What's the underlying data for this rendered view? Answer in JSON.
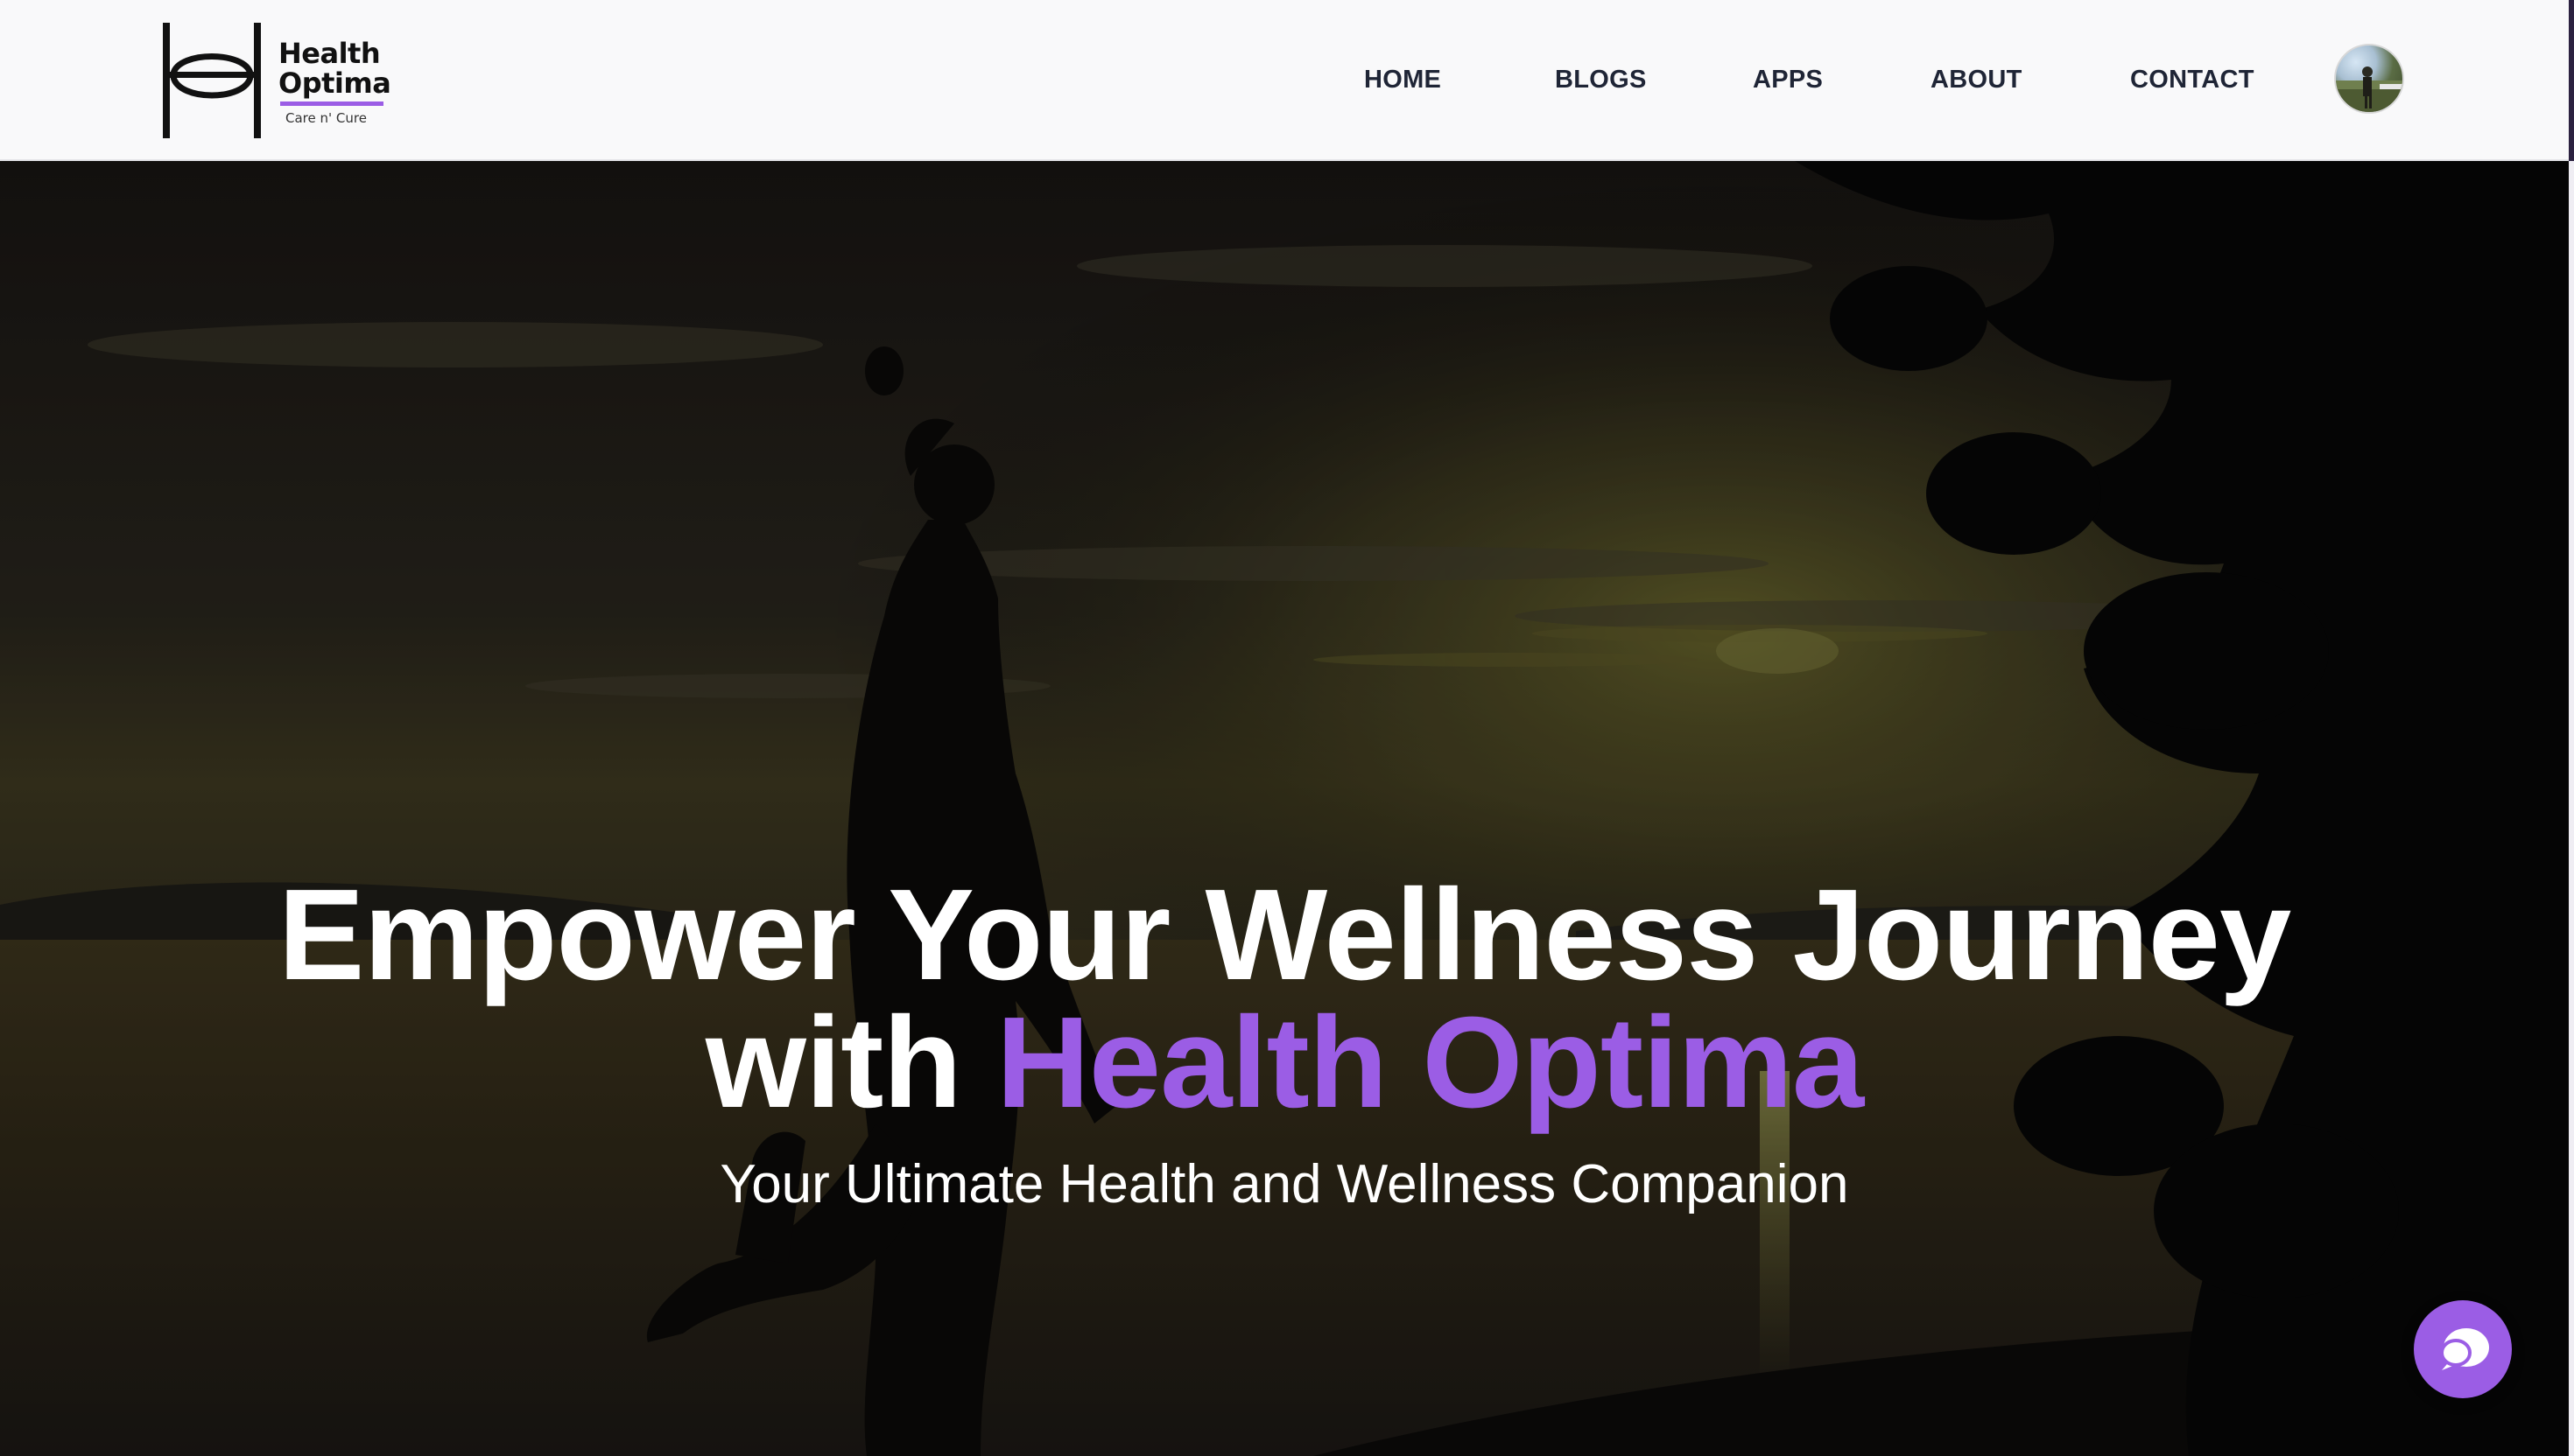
{
  "brand": {
    "name": "Health Optima",
    "tagline": "Care n' Cure",
    "accent_color": "#9b5de5"
  },
  "nav": {
    "items": [
      {
        "label": "HOME"
      },
      {
        "label": "BLOGS"
      },
      {
        "label": "APPS"
      },
      {
        "label": "ABOUT"
      },
      {
        "label": "CONTACT"
      }
    ],
    "avatar_icon": "user-avatar"
  },
  "hero": {
    "title_line1": "Empower Your Wellness Journey",
    "title_line2_prefix": "with ",
    "title_line2_accent": "Health Optima",
    "subtitle": "Your Ultimate Health and Wellness Companion",
    "background": "sunset-silhouette-woman-lake"
  },
  "chat": {
    "icon": "chat-bubble-icon",
    "color": "#9b5de5"
  }
}
